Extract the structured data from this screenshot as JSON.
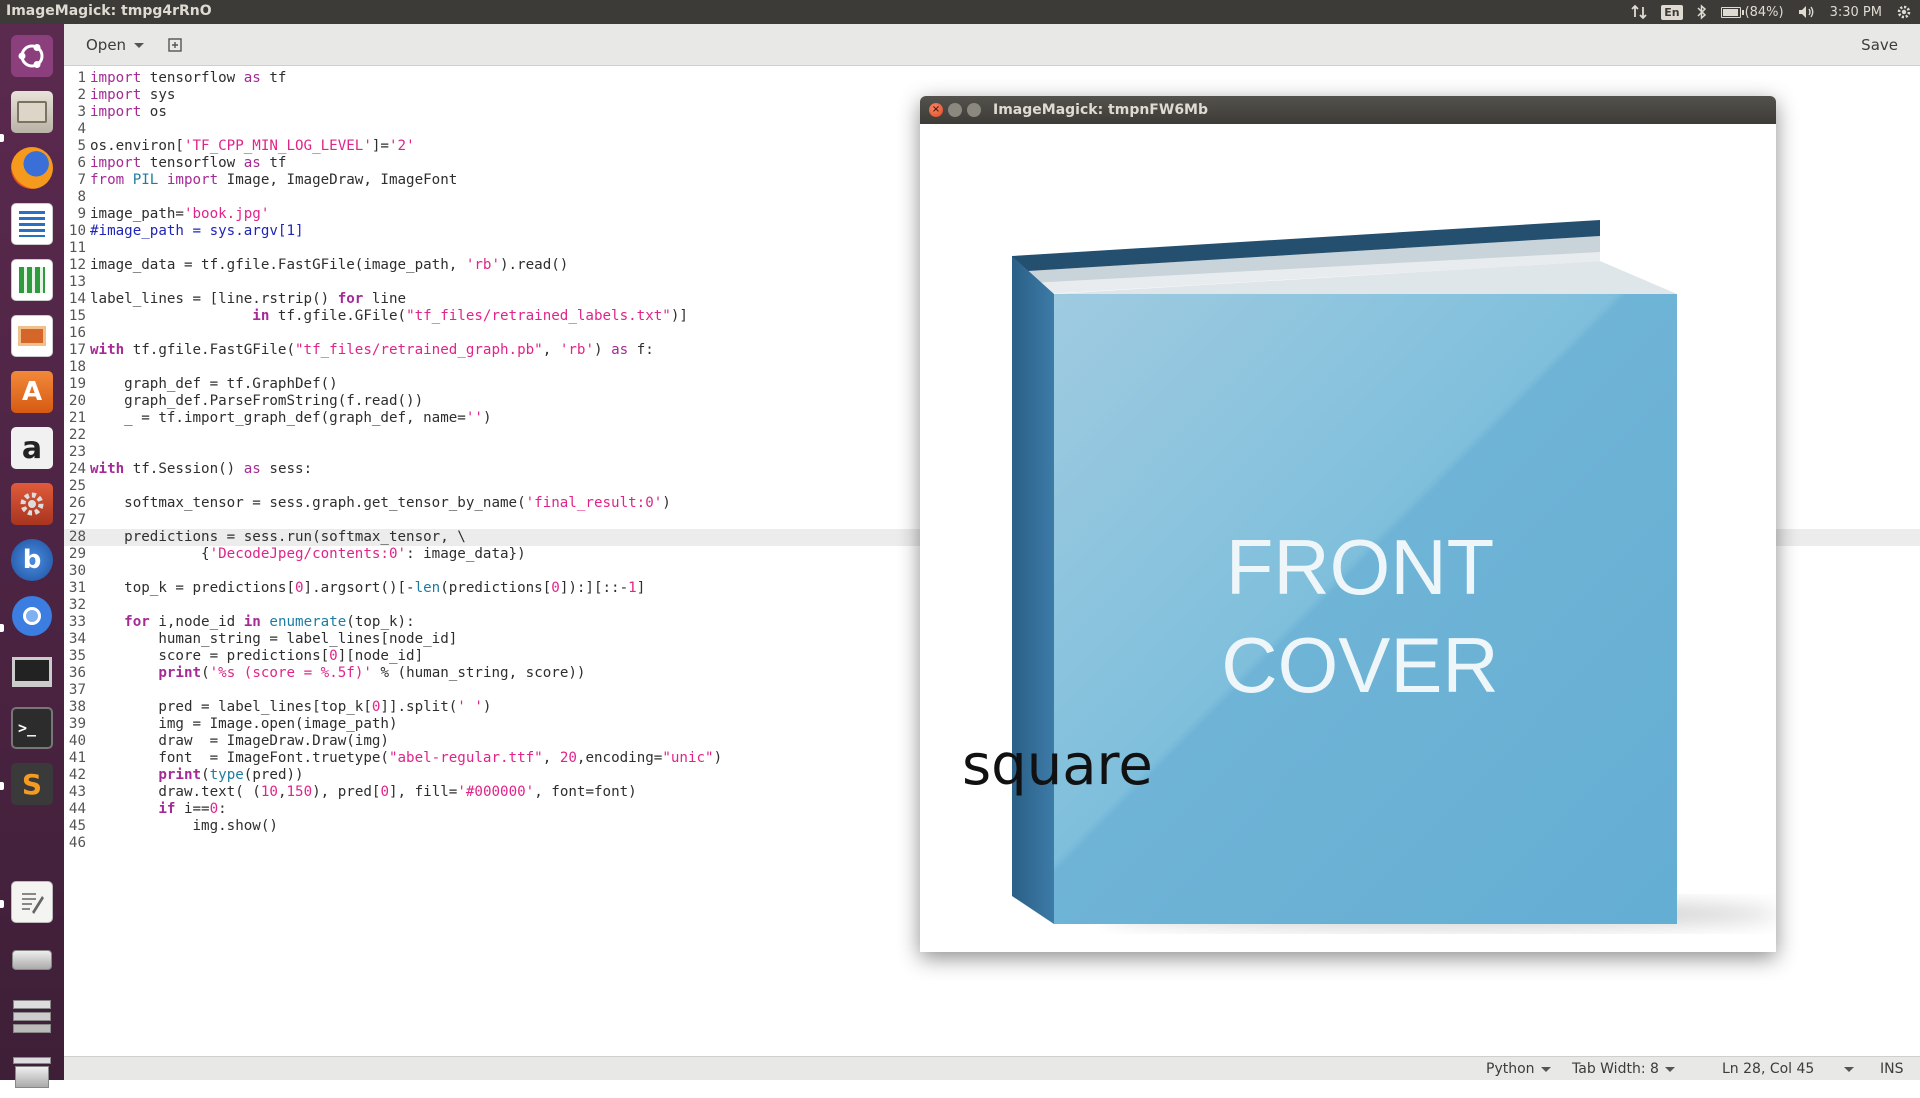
{
  "top_panel": {
    "title": "ImageMagick: tmpg4rRnO",
    "keyboard": "En",
    "battery": "(84%)",
    "battery_level": 0.84,
    "time": "3:30 PM"
  },
  "launcher": {
    "items": [
      {
        "name": "ubuntu-dash-icon"
      },
      {
        "name": "files-icon"
      },
      {
        "name": "firefox-icon"
      },
      {
        "name": "libreoffice-writer-icon"
      },
      {
        "name": "libreoffice-calc-icon"
      },
      {
        "name": "libreoffice-impress-icon"
      },
      {
        "name": "software-center-icon"
      },
      {
        "name": "amazon-icon",
        "glyph": "a"
      },
      {
        "name": "system-settings-icon"
      },
      {
        "name": "app-b-icon",
        "glyph": "b"
      },
      {
        "name": "chromium-icon"
      },
      {
        "name": "display-icon"
      },
      {
        "name": "terminal-icon",
        "glyph": ">_"
      },
      {
        "name": "sublime-text-icon",
        "glyph": "S"
      },
      {
        "name": "text-editor-icon"
      },
      {
        "name": "drive-icon"
      },
      {
        "name": "workspace-switcher-icon"
      },
      {
        "name": "trash-icon"
      }
    ]
  },
  "editor": {
    "open_label": "Open",
    "save_label": "Save",
    "current_line": 28,
    "lines": [
      [
        [
          "kw2",
          "import"
        ],
        [
          "t",
          " tensorflow "
        ],
        [
          "kw2",
          "as"
        ],
        [
          "t",
          " tf"
        ]
      ],
      [
        [
          "kw2",
          "import"
        ],
        [
          "t",
          " sys"
        ]
      ],
      [
        [
          "kw2",
          "import"
        ],
        [
          "t",
          " os"
        ]
      ],
      [],
      [
        [
          "t",
          "os.environ["
        ],
        [
          "str",
          "'TF_CPP_MIN_LOG_LEVEL'"
        ],
        [
          "t",
          "]="
        ],
        [
          "str",
          "'2'"
        ]
      ],
      [
        [
          "kw2",
          "import"
        ],
        [
          "t",
          " tensorflow "
        ],
        [
          "kw2",
          "as"
        ],
        [
          "t",
          " tf"
        ]
      ],
      [
        [
          "kw2",
          "from"
        ],
        [
          "t",
          " "
        ],
        [
          "bi",
          "PIL"
        ],
        [
          "t",
          " "
        ],
        [
          "kw2",
          "import"
        ],
        [
          "t",
          " Image, ImageDraw, ImageFont"
        ]
      ],
      [],
      [
        [
          "t",
          "image_path="
        ],
        [
          "str",
          "'book.jpg'"
        ]
      ],
      [
        [
          "cm",
          "#image_path = sys.argv[1]"
        ]
      ],
      [],
      [
        [
          "t",
          "image_data = tf.gfile.FastGFile(image_path, "
        ],
        [
          "str",
          "'rb'"
        ],
        [
          "t",
          ").read()"
        ]
      ],
      [],
      [
        [
          "t",
          "label_lines = [line.rstrip() "
        ],
        [
          "kw",
          "for"
        ],
        [
          "t",
          " line"
        ]
      ],
      [
        [
          "t",
          "                   "
        ],
        [
          "kw",
          "in"
        ],
        [
          "t",
          " tf.gfile.GFile("
        ],
        [
          "str",
          "\"tf_files/retrained_labels.txt\""
        ],
        [
          "t",
          ")]"
        ]
      ],
      [],
      [
        [
          "kw",
          "with"
        ],
        [
          "t",
          " tf.gfile.FastGFile("
        ],
        [
          "str",
          "\"tf_files/retrained_graph.pb\""
        ],
        [
          "t",
          ", "
        ],
        [
          "str",
          "'rb'"
        ],
        [
          "t",
          ") "
        ],
        [
          "kw2",
          "as"
        ],
        [
          "t",
          " f:"
        ]
      ],
      [],
      [
        [
          "t",
          "    graph_def = tf.GraphDef()"
        ]
      ],
      [
        [
          "t",
          "    graph_def.ParseFromString(f.read())"
        ]
      ],
      [
        [
          "t",
          "    _ = tf.import_graph_def(graph_def, name="
        ],
        [
          "str",
          "''"
        ],
        [
          "t",
          ")"
        ]
      ],
      [],
      [],
      [
        [
          "kw",
          "with"
        ],
        [
          "t",
          " tf.Session() "
        ],
        [
          "kw2",
          "as"
        ],
        [
          "t",
          " sess:"
        ]
      ],
      [],
      [
        [
          "t",
          "    softmax_tensor = sess.graph.get_tensor_by_name("
        ],
        [
          "str",
          "'final_result:0'"
        ],
        [
          "t",
          ")"
        ]
      ],
      [],
      [
        [
          "t",
          "    predictions = sess.run(softmax_tensor, \\"
        ]
      ],
      [
        [
          "t",
          "             {"
        ],
        [
          "str",
          "'DecodeJpeg/contents:0'"
        ],
        [
          "t",
          ": image_data})"
        ]
      ],
      [],
      [
        [
          "t",
          "    top_k = predictions["
        ],
        [
          "num",
          "0"
        ],
        [
          "t",
          "].argsort()[-"
        ],
        [
          "bi",
          "len"
        ],
        [
          "t",
          "(predictions["
        ],
        [
          "num",
          "0"
        ],
        [
          "t",
          "]):][::-"
        ],
        [
          "num",
          "1"
        ],
        [
          "t",
          "]"
        ]
      ],
      [],
      [
        [
          "t",
          "    "
        ],
        [
          "kw",
          "for"
        ],
        [
          "t",
          " i,node_id "
        ],
        [
          "kw",
          "in"
        ],
        [
          "t",
          " "
        ],
        [
          "bi",
          "enumerate"
        ],
        [
          "t",
          "(top_k):"
        ]
      ],
      [
        [
          "t",
          "        human_string = label_lines[node_id]"
        ]
      ],
      [
        [
          "t",
          "        score = predictions["
        ],
        [
          "num",
          "0"
        ],
        [
          "t",
          "][node_id]"
        ]
      ],
      [
        [
          "t",
          "        "
        ],
        [
          "kw",
          "print"
        ],
        [
          "t",
          "("
        ],
        [
          "str",
          "'%s (score = %.5f)'"
        ],
        [
          "t",
          " % (human_string, score))"
        ]
      ],
      [],
      [
        [
          "t",
          "        pred = label_lines[top_k["
        ],
        [
          "num",
          "0"
        ],
        [
          "t",
          "]].split("
        ],
        [
          "str",
          "' '"
        ],
        [
          "t",
          ")"
        ]
      ],
      [
        [
          "t",
          "        img = Image.open(image_path)"
        ]
      ],
      [
        [
          "t",
          "        draw  = ImageDraw.Draw(img)"
        ]
      ],
      [
        [
          "t",
          "        font  = ImageFont.truetype("
        ],
        [
          "str",
          "\"abel-regular.ttf\""
        ],
        [
          "t",
          ", "
        ],
        [
          "num",
          "20"
        ],
        [
          "t",
          ",encoding="
        ],
        [
          "str",
          "\"unic\""
        ],
        [
          "t",
          ")"
        ]
      ],
      [
        [
          "t",
          "        "
        ],
        [
          "kw",
          "print"
        ],
        [
          "t",
          "("
        ],
        [
          "bi",
          "type"
        ],
        [
          "t",
          "(pred))"
        ]
      ],
      [
        [
          "t",
          "        draw.text( ("
        ],
        [
          "num",
          "10"
        ],
        [
          "t",
          ","
        ],
        [
          "num",
          "150"
        ],
        [
          "t",
          "), pred["
        ],
        [
          "num",
          "0"
        ],
        [
          "t",
          "], fill="
        ],
        [
          "str",
          "'#000000'"
        ],
        [
          "t",
          ", font=font)"
        ]
      ],
      [
        [
          "t",
          "        "
        ],
        [
          "kw",
          "if"
        ],
        [
          "t",
          " i=="
        ],
        [
          "num",
          "0"
        ],
        [
          "t",
          ":"
        ]
      ],
      [
        [
          "t",
          "            img.show()"
        ]
      ],
      []
    ]
  },
  "status_bar": {
    "language": "Python",
    "tab_width": "Tab Width: 8",
    "position": "Ln 28, Col 45",
    "mode": "INS"
  },
  "image_window": {
    "title": "ImageMagick: tmpnFW6Mb",
    "close_glyph": "×",
    "cover_line1": "FRONT",
    "cover_line2": "COVER",
    "overlay_text": "square"
  }
}
